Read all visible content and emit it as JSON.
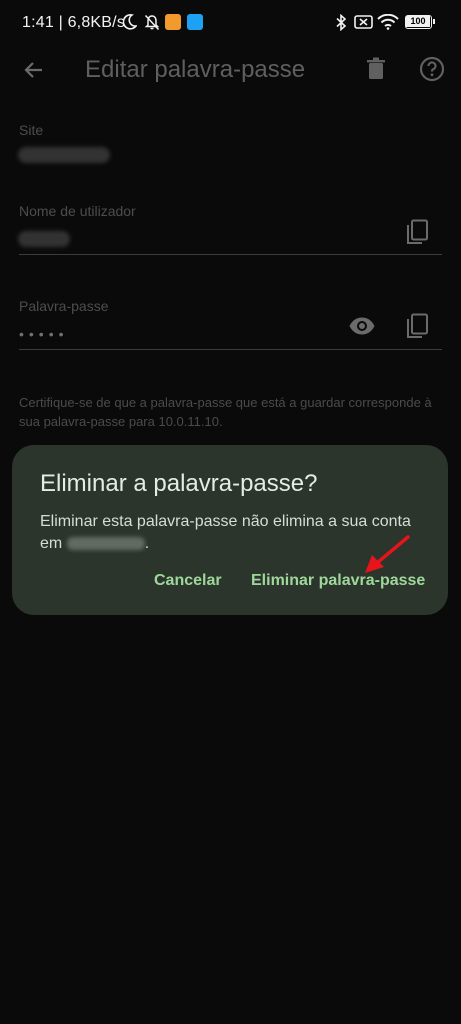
{
  "status_bar": {
    "time_speed": "1:41 | 6,8KB/s",
    "battery": "100",
    "colors": {
      "app_badge_1": "#f29a2e",
      "app_badge_2": "#1da1f2"
    }
  },
  "app_bar": {
    "title": "Editar palavra-passe",
    "back_icon": "arrow-back-icon",
    "delete_icon": "trash-icon",
    "help_icon": "help-circle-icon"
  },
  "form": {
    "site_label": "Site",
    "username_label": "Nome de utilizador",
    "password_label": "Palavra-passe",
    "password_masked": "•••••",
    "hint": "Certifique-se de que a palavra-passe que está a guardar corresponde à sua palavra-passe para 10.0.11.10."
  },
  "dialog": {
    "title": "Eliminar a palavra-passe?",
    "body_prefix": "Eliminar esta palavra-passe não elimina a sua conta em",
    "body_suffix": ".",
    "cancel_label": "Cancelar",
    "confirm_label": "Eliminar palavra-passe",
    "colors": {
      "surface": "#2b352c",
      "accent": "#9fd79b",
      "annotation_arrow": "#e8141c"
    }
  }
}
